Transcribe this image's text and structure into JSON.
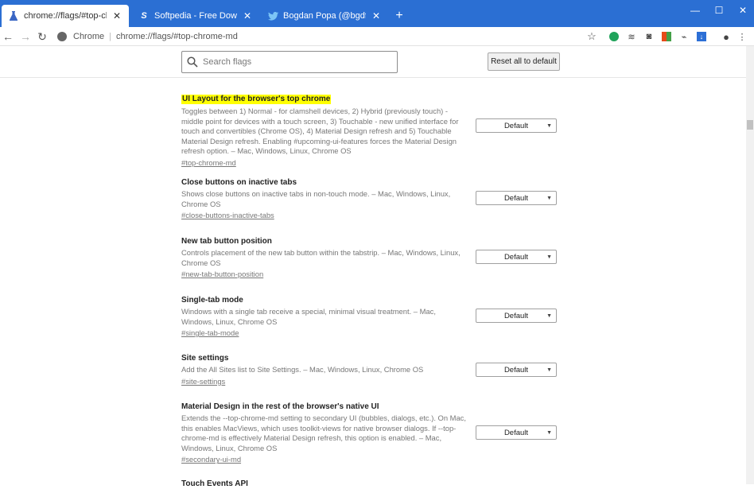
{
  "tabs": [
    {
      "title": "chrome://flags/#top-chrome-md",
      "icon": "flask-icon",
      "active": true
    },
    {
      "title": "Softpedia - Free Downloads Ency",
      "icon": "softpedia-icon",
      "active": false
    },
    {
      "title": "Bogdan Popa (@bgdftw) | Twitter",
      "icon": "twitter-icon",
      "active": false
    }
  ],
  "window": {
    "minimize": "—",
    "maximize": "☐",
    "close": "✕"
  },
  "toolbar": {
    "site_chip": "Chrome",
    "url": "chrome://flags/#top-chrome-md"
  },
  "flags_header": {
    "search_placeholder": "Search flags",
    "reset_label": "Reset all to default"
  },
  "flags": [
    {
      "name": "UI Layout for the browser's top chrome",
      "highlighted": true,
      "desc": "Toggles between 1) Normal - for clamshell devices, 2) Hybrid (previously touch) - middle point for devices with a touch screen, 3) Touchable - new unified interface for touch and convertibles (Chrome OS), 4) Material Design refresh and 5) Touchable Material Design refresh. Enabling #upcoming-ui-features forces the Material Design refresh option. – Mac, Windows, Linux, Chrome OS",
      "anchor": "#top-chrome-md",
      "value": "Default"
    },
    {
      "name": "Close buttons on inactive tabs",
      "highlighted": false,
      "desc": "Shows close buttons on inactive tabs in non-touch mode. – Mac, Windows, Linux, Chrome OS",
      "anchor": "#close-buttons-inactive-tabs",
      "value": "Default"
    },
    {
      "name": "New tab button position",
      "highlighted": false,
      "desc": "Controls placement of the new tab button within the tabstrip. – Mac, Windows, Linux, Chrome OS",
      "anchor": "#new-tab-button-position",
      "value": "Default"
    },
    {
      "name": "Single-tab mode",
      "highlighted": false,
      "desc": "Windows with a single tab receive a special, minimal visual treatment. – Mac, Windows, Linux, Chrome OS",
      "anchor": "#single-tab-mode",
      "value": "Default"
    },
    {
      "name": "Site settings",
      "highlighted": false,
      "desc": "Add the All Sites list to Site Settings. – Mac, Windows, Linux, Chrome OS",
      "anchor": "#site-settings",
      "value": "Default"
    },
    {
      "name": "Material Design in the rest of the browser's native UI",
      "highlighted": false,
      "desc": "Extends the --top-chrome-md setting to secondary UI (bubbles, dialogs, etc.). On Mac, this enables MacViews, which uses toolkit-views for native browser dialogs. If --top-chrome-md is effectively Material Design refresh, this option is enabled. – Mac, Windows, Linux, Chrome OS",
      "anchor": "#secondary-ui-md",
      "value": "Default"
    },
    {
      "name": "Touch Events API",
      "highlighted": false,
      "desc": "",
      "anchor": "",
      "value": ""
    }
  ],
  "colors": {
    "tab_strip": "#2b6fd3",
    "highlight": "#ffff00"
  }
}
